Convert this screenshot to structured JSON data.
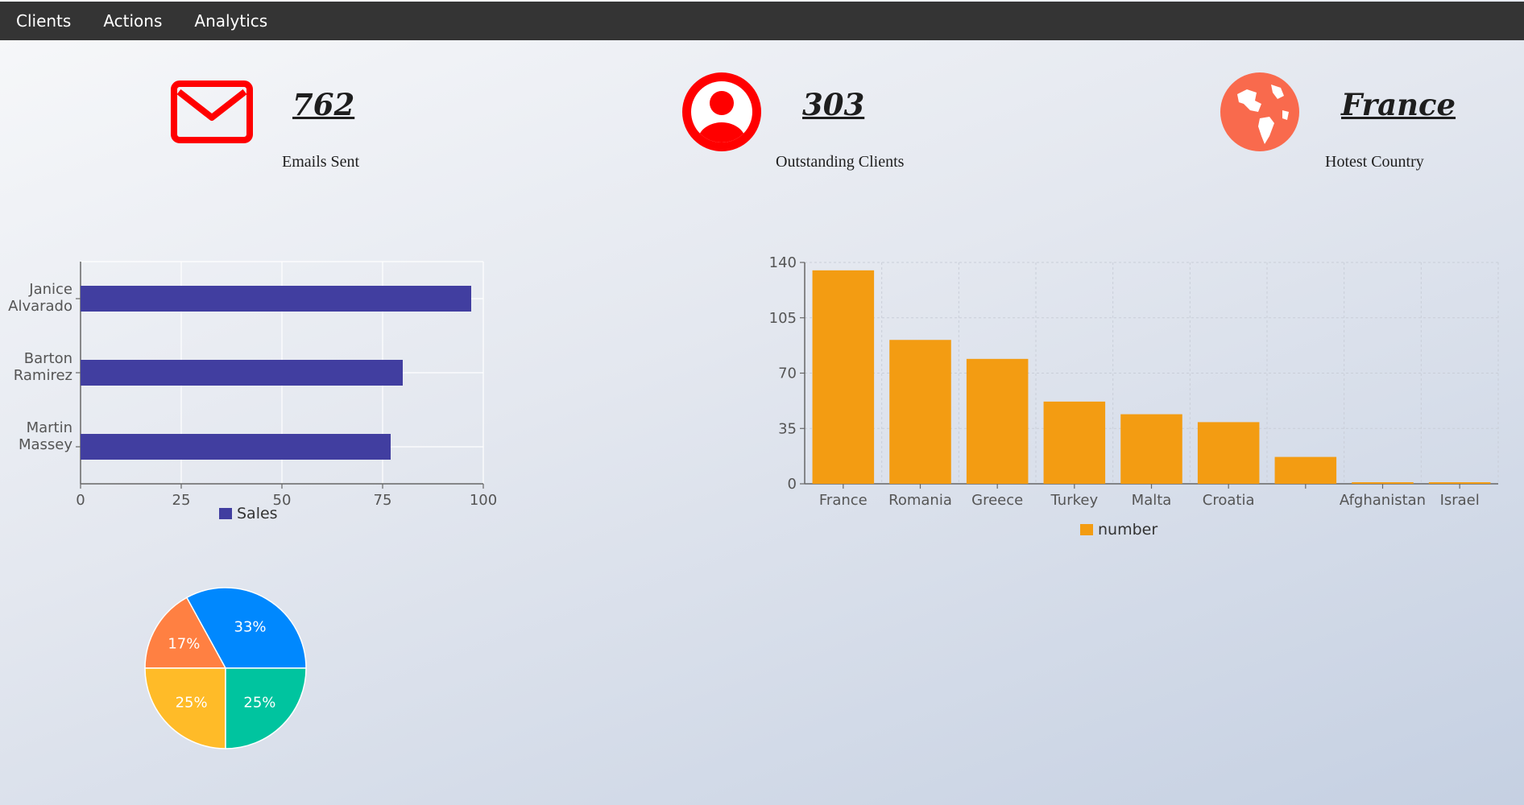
{
  "nav": {
    "items": [
      "Clients",
      "Actions",
      "Analytics"
    ]
  },
  "stats": {
    "emails": {
      "value": "762",
      "label": "Emails Sent",
      "icon": "envelope-icon",
      "color": "#ff0000"
    },
    "clients": {
      "value": "303",
      "label": "Outstanding Clients",
      "icon": "user-circle-icon",
      "color": "#ff0000"
    },
    "country": {
      "value": "France",
      "label": "Hotest Country",
      "icon": "globe-icon",
      "color": "#f96a4d"
    }
  },
  "chart_data": [
    {
      "type": "bar",
      "orientation": "horizontal",
      "categories": [
        "Janice Alvarado",
        "Barton Ramirez",
        "Martin Massey"
      ],
      "series": [
        {
          "name": "Sales",
          "values": [
            97,
            80,
            77
          ],
          "color": "#413ea0"
        }
      ],
      "xlim": [
        0,
        100
      ],
      "xticks": [
        0,
        25,
        50,
        75,
        100
      ],
      "grid": true,
      "legend": "bottom"
    },
    {
      "type": "bar",
      "categories": [
        "France",
        "Romania",
        "Greece",
        "Turkey",
        "Malta",
        "Croatia",
        "",
        "Afghanistan",
        "Israel"
      ],
      "series": [
        {
          "name": "number",
          "values": [
            135,
            91,
            79,
            52,
            44,
            39,
            17,
            1,
            1
          ],
          "color": "#f39c12"
        }
      ],
      "ylim": [
        0,
        140
      ],
      "yticks": [
        0,
        35,
        70,
        105,
        140
      ],
      "grid": true,
      "legend": "bottom"
    },
    {
      "type": "pie",
      "slices": [
        {
          "label": "33%",
          "value": 33,
          "color": "#0088fe"
        },
        {
          "label": "17%",
          "value": 17,
          "color": "#ff8042"
        },
        {
          "label": "25%",
          "value": 25,
          "color": "#ffbb28"
        },
        {
          "label": "25%",
          "value": 25,
          "color": "#00c49f"
        }
      ]
    }
  ]
}
